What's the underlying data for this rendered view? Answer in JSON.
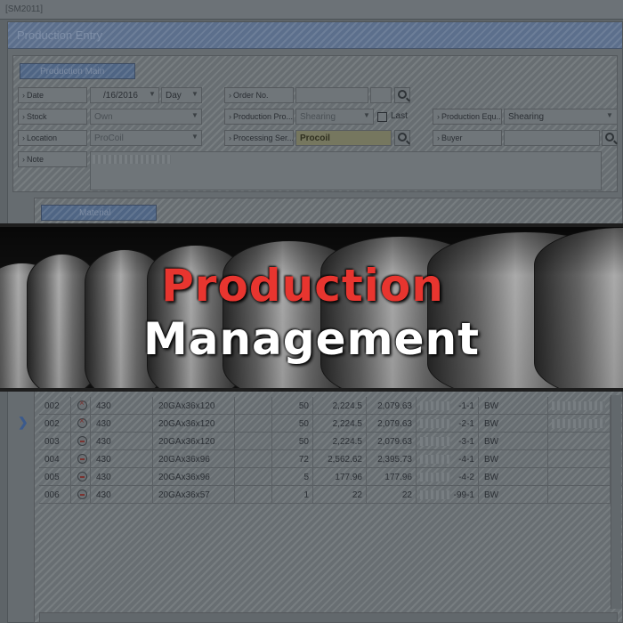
{
  "window_title": "[SM2011]",
  "page_title": "Production Entry",
  "sections": {
    "main": "Production Main",
    "material": "Material"
  },
  "form": {
    "date": {
      "label": "Date",
      "value": "/16/2016",
      "period": "Day"
    },
    "order_no": {
      "label": "Order No.",
      "value": ""
    },
    "stock": {
      "label": "Stock",
      "value": "Own"
    },
    "production_process": {
      "label": "Production Pro...",
      "value": "Shearing",
      "last_label": "Last"
    },
    "production_equipment": {
      "label": "Production Equ...",
      "value": "Shearing"
    },
    "location": {
      "label": "Location",
      "value": "ProCoil"
    },
    "processing_service": {
      "label": "Processing Ser...",
      "value": "Procoil"
    },
    "buyer": {
      "label": "Buyer",
      "value": ""
    },
    "note": {
      "label": "Note",
      "value": ""
    }
  },
  "banner": {
    "line1": "Production",
    "line2": "Management"
  },
  "table": {
    "rows": [
      {
        "no": "002",
        "status": "x",
        "grade": "430",
        "spec": "20GAx36x120",
        "qty": "50",
        "w1": "2,224.5",
        "w2": "2,079.63",
        "tag": "-1-1",
        "code": "BW"
      },
      {
        "no": "002",
        "status": "x",
        "grade": "430",
        "spec": "20GAx36x120",
        "qty": "50",
        "w1": "2,224.5",
        "w2": "2,079.63",
        "tag": "-2-1",
        "code": "BW"
      },
      {
        "no": "003",
        "status": "m",
        "grade": "430",
        "spec": "20GAx36x120",
        "qty": "50",
        "w1": "2,224.5",
        "w2": "2,079.63",
        "tag": "-3-1",
        "code": "BW"
      },
      {
        "no": "004",
        "status": "m",
        "grade": "430",
        "spec": "20GAx36x96",
        "qty": "72",
        "w1": "2,562.62",
        "w2": "2,395.73",
        "tag": "-4-1",
        "code": "BW"
      },
      {
        "no": "005",
        "status": "m",
        "grade": "430",
        "spec": "20GAx36x96",
        "qty": "5",
        "w1": "177.96",
        "w2": "177.96",
        "tag": "-4-2",
        "code": "BW"
      },
      {
        "no": "006",
        "status": "m",
        "grade": "430",
        "spec": "20GAx36x57",
        "qty": "1",
        "w1": "22",
        "w2": "22",
        "tag": "-99-1",
        "code": "BW"
      }
    ]
  },
  "colors": {
    "accent_red": "#e8352f",
    "header_blue": "#5c6f8c"
  }
}
